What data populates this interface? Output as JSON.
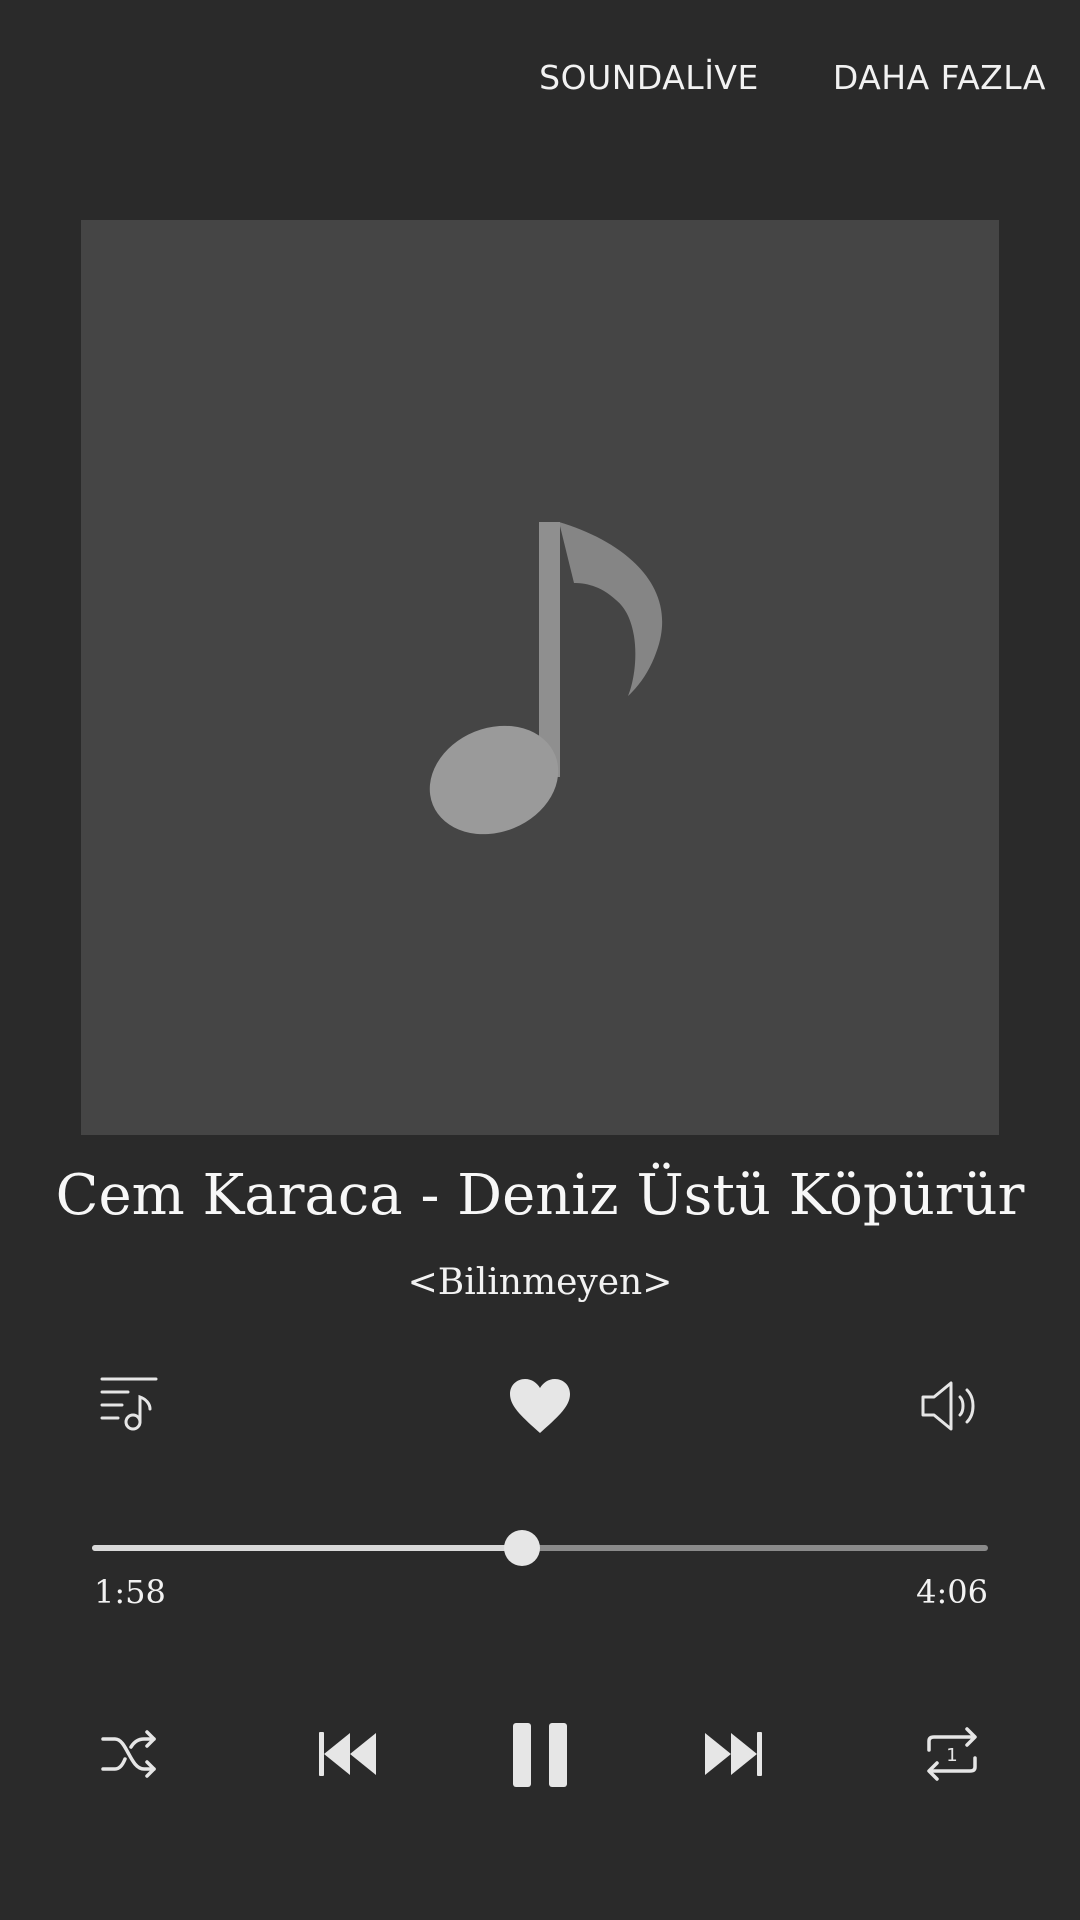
{
  "header": {
    "soundalive_label": "SOUNDALİVE",
    "more_label": "DAHA FAZLA"
  },
  "track": {
    "title": "Cem Karaca - Deniz Üstü Köpürür",
    "artist": "<Bilinmeyen>",
    "album_art": "music-note-placeholder-icon"
  },
  "actions": {
    "playlist_icon": "queue-music-icon",
    "favorite_icon": "heart-icon",
    "favorite_active": true,
    "volume_icon": "volume-icon"
  },
  "progress": {
    "elapsed": "1:58",
    "total": "4:06",
    "fraction": 0.48
  },
  "controls": {
    "shuffle_icon": "shuffle-icon",
    "previous_icon": "skip-previous-icon",
    "play_state": "playing",
    "pause_icon": "pause-icon",
    "next_icon": "skip-next-icon",
    "repeat_icon": "repeat-one-icon"
  },
  "colors": {
    "background": "#2a2a2a",
    "album_bg": "#454545",
    "icon": "#e6e6e6",
    "seek_played": "#d9d9d9",
    "seek_remaining": "#8a8a8a"
  }
}
